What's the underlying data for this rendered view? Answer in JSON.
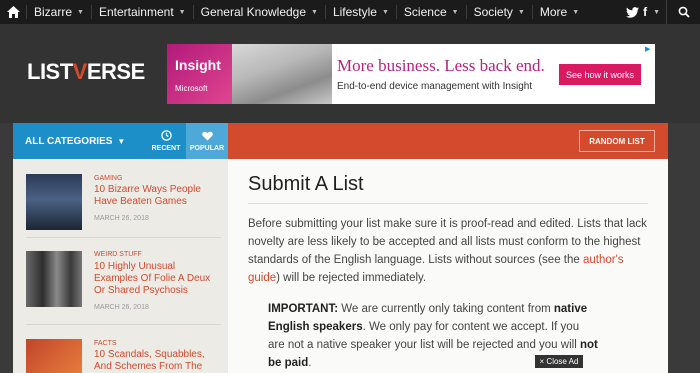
{
  "nav": {
    "items": [
      {
        "label": "Bizarre"
      },
      {
        "label": "Entertainment"
      },
      {
        "label": "General Knowledge"
      },
      {
        "label": "Lifestyle"
      },
      {
        "label": "Science"
      },
      {
        "label": "Society"
      },
      {
        "label": "More"
      }
    ],
    "icons": [
      "home-icon",
      "twitter-icon",
      "facebook-icon",
      "search-icon"
    ]
  },
  "header": {
    "logo_a": "LIST",
    "logo_v": "V",
    "logo_b": "ERSE",
    "ad": {
      "brand": "Insight",
      "brand_sub": "Microsoft",
      "headline": "More business. Less back end.",
      "subline": "End-to-end device management with Insight",
      "cta": "See how it works"
    }
  },
  "catbar": {
    "all_categories": "ALL CATEGORIES",
    "recent": "RECENT",
    "popular": "POPULAR",
    "random": "RANDOM LIST"
  },
  "sidebar": {
    "items": [
      {
        "category": "GAMING",
        "title": "10 Bizarre Ways People Have Beaten Games",
        "date": "MARCH 26, 2018"
      },
      {
        "category": "WEIRD STUFF",
        "title": "10 Highly Unusual Examples Of Folie A Deux Or Shared Psychosis",
        "date": "MARCH 26, 2018"
      },
      {
        "category": "FACTS",
        "title": "10 Scandals, Squabbles, And Schemes From The",
        "date": ""
      }
    ]
  },
  "main": {
    "title": "Submit A List",
    "para_1": "Before submitting your list make sure it is proof-read and edited. Lists that lack novelty are less likely to be accepted and all lists must conform to the highest standards of the English language. Lists without sources (see the ",
    "para_link": "author's guide",
    "para_2": ") will be rejected immediately.",
    "imp_label": "IMPORTANT:",
    "imp_1": " We are currently only taking content from ",
    "imp_bold_1": "native English speakers",
    "imp_2": ". We only pay for content we accept. If you are not a native speaker your list will be rejected and you will ",
    "imp_bold_2": "not be paid",
    "imp_3": "."
  },
  "close_ad": "× Close Ad",
  "colors": {
    "accent": "#d34a2c",
    "blue": "#1d8fc8",
    "nav_bg": "#1b1b1b",
    "header_bg": "#333333"
  }
}
